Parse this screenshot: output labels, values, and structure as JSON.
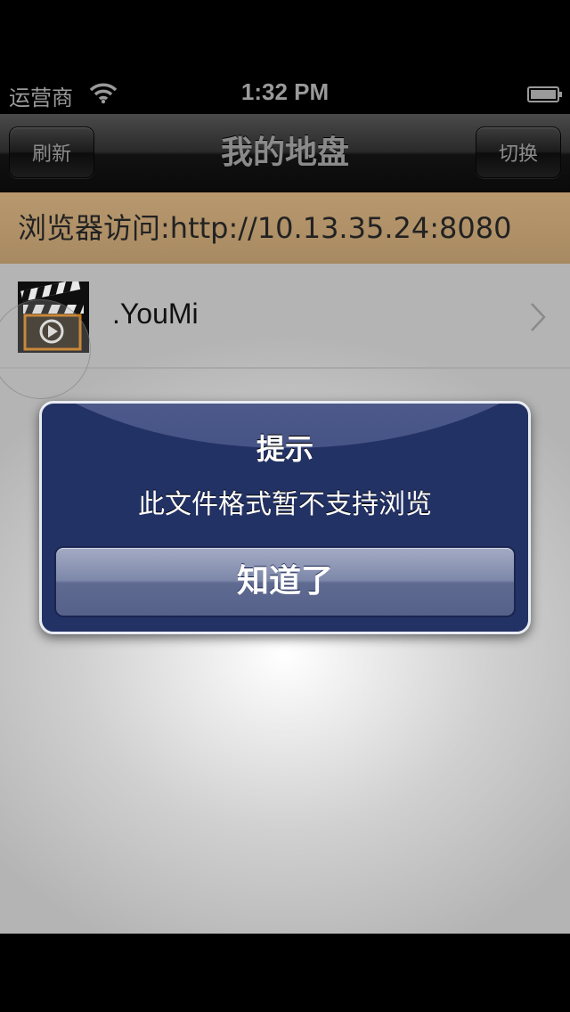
{
  "status_bar": {
    "carrier": "运营商",
    "time": "1:32 PM",
    "wifi_icon": "wifi-icon",
    "battery_icon": "battery-icon"
  },
  "nav_bar": {
    "title": "我的地盘",
    "left_button": "刷新",
    "right_button": "切换"
  },
  "banner": {
    "text": "浏览器访问:http://10.13.35.24:8080"
  },
  "file_list": [
    {
      "name": ".YouMi",
      "icon": "video-file-icon",
      "accessory": "chevron-right-icon"
    }
  ],
  "alert": {
    "title": "提示",
    "message": "此文件格式暂不支持浏览",
    "button": "知道了"
  },
  "colors": {
    "banner_background": "#b0916a",
    "alert_background": "#233265",
    "navbar_background": "#1a1a1a"
  }
}
